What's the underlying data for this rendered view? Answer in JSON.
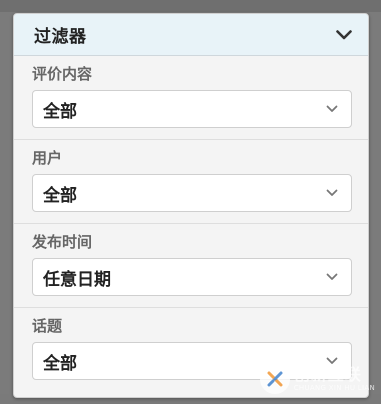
{
  "filter": {
    "title": "过滤器",
    "sections": [
      {
        "label": "评价内容",
        "value": "全部"
      },
      {
        "label": "用户",
        "value": "全部"
      },
      {
        "label": "发布时间",
        "value": "任意日期"
      },
      {
        "label": "话题",
        "value": "全部"
      }
    ]
  },
  "watermark": {
    "main": "创新互联",
    "sub": "CHUANG XIN HU LIAN"
  },
  "colors": {
    "header_bg": "#e8f3f8",
    "panel_bg": "#f4f4f4",
    "page_bg": "#7b7b7b",
    "select_bg": "#ffffff"
  },
  "icons": {
    "header_toggle": "chevron-down-icon",
    "select_arrow": "chevron-down-icon",
    "watermark_logo": "x-logo-icon"
  }
}
